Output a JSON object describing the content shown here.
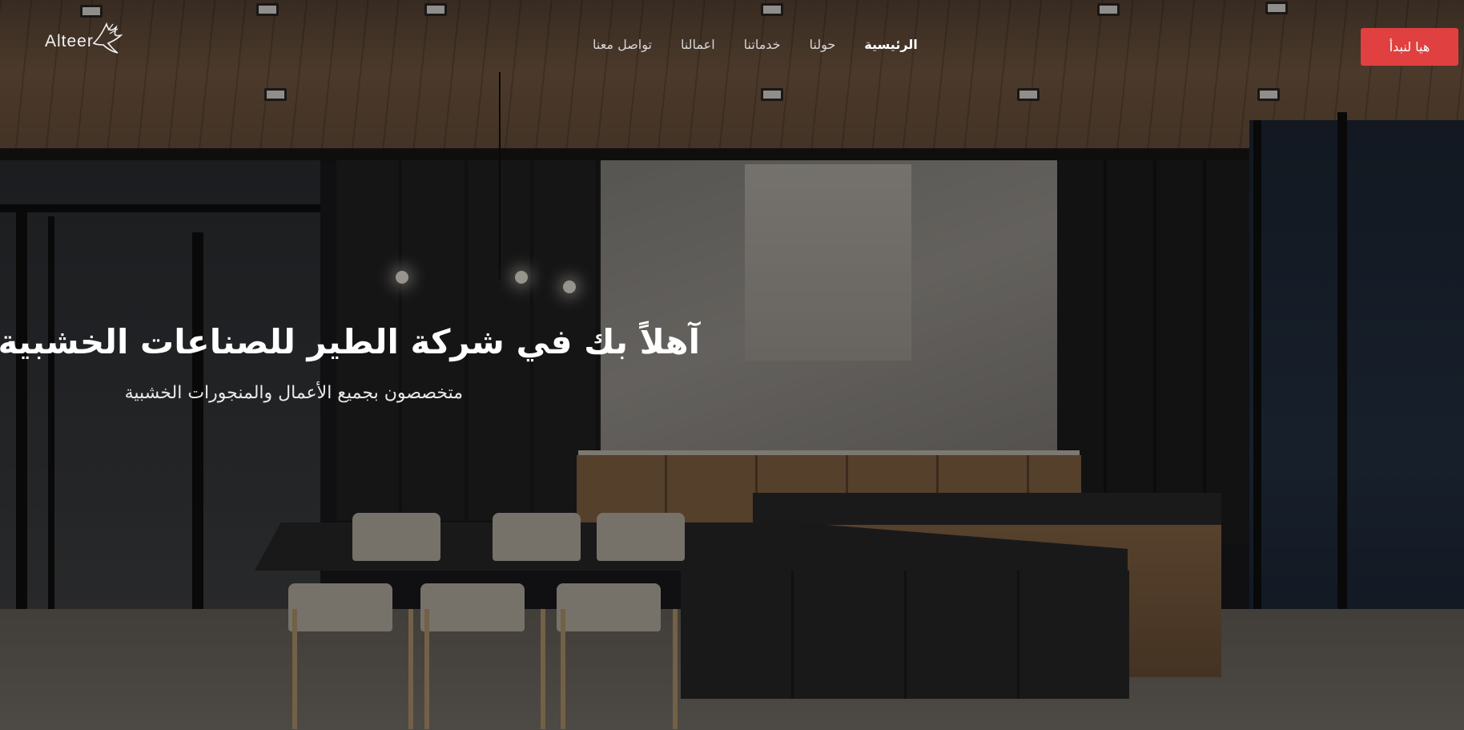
{
  "header": {
    "logo_text": "Alteer",
    "nav": [
      {
        "label": "الرئيسية",
        "active": true
      },
      {
        "label": "حولنا",
        "active": false
      },
      {
        "label": "خدماتنا",
        "active": false
      },
      {
        "label": "اعمالنا",
        "active": false
      },
      {
        "label": "تواصل معنا",
        "active": false
      }
    ],
    "cta_label": "هيا لنبدأ"
  },
  "hero": {
    "title": "آهلاً بك في شركة الطير للصناعات الخشبية",
    "subtitle": "متخصصون بجميع الأعمال والمنجورات الخشبية"
  },
  "colors": {
    "accent": "#e04040",
    "text_primary": "#ffffff",
    "nav_text": "#d7d7d7"
  },
  "icons": {
    "logo_mark": "bird-icon"
  }
}
